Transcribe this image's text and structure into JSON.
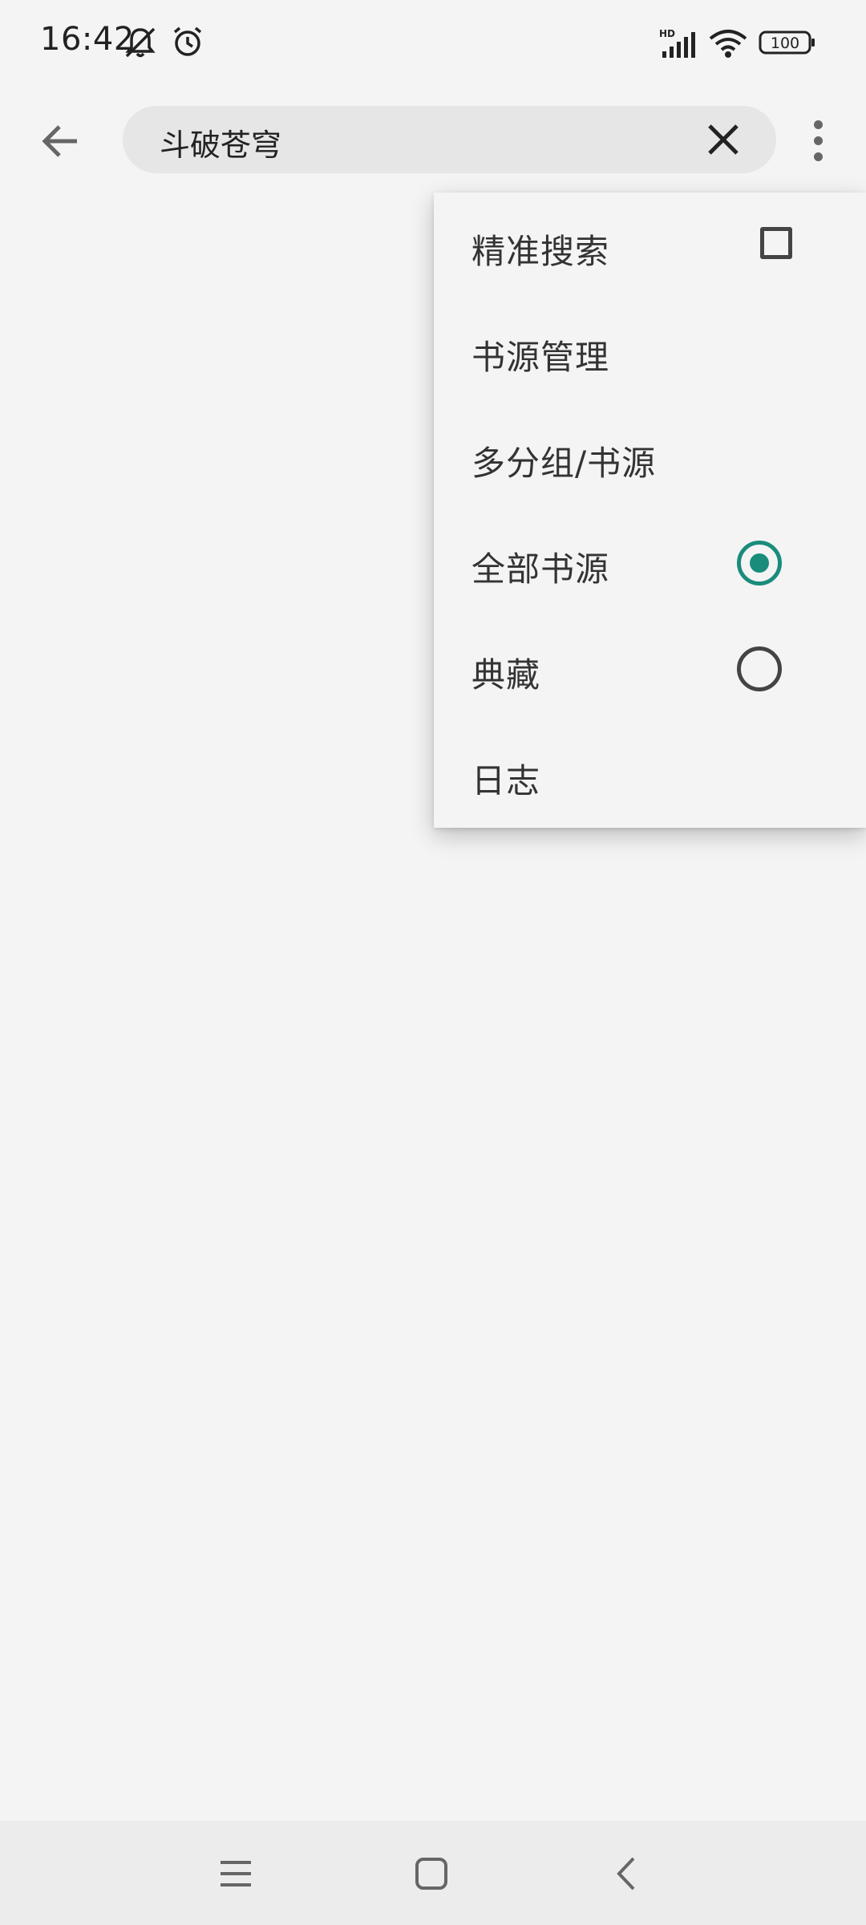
{
  "status_bar": {
    "time": "16:42",
    "icons": [
      "bell-muted-icon",
      "alarm-icon",
      "hd-signal-icon",
      "wifi-icon",
      "battery-icon"
    ],
    "battery": "100"
  },
  "app_bar": {
    "search_text": "斗破苍穹",
    "back_icon": "arrow-left-icon",
    "clear_icon": "close-icon",
    "overflow_icon": "more-vert-icon"
  },
  "menu": {
    "items": [
      {
        "label": "精准搜索",
        "control": "checkbox",
        "checked": false
      },
      {
        "label": "书源管理"
      },
      {
        "label": "多分组/书源"
      },
      {
        "label": "全部书源",
        "control": "radio",
        "checked": true
      },
      {
        "label": "典藏",
        "control": "radio",
        "checked": false
      },
      {
        "label": "日志"
      }
    ]
  },
  "nav_bar": {
    "icons": [
      "menu-icon",
      "home-icon",
      "back-icon"
    ]
  },
  "colors": {
    "background": "#f4f4f4",
    "accent": "#1a8c7c",
    "search_box": "#e6e6e6"
  }
}
